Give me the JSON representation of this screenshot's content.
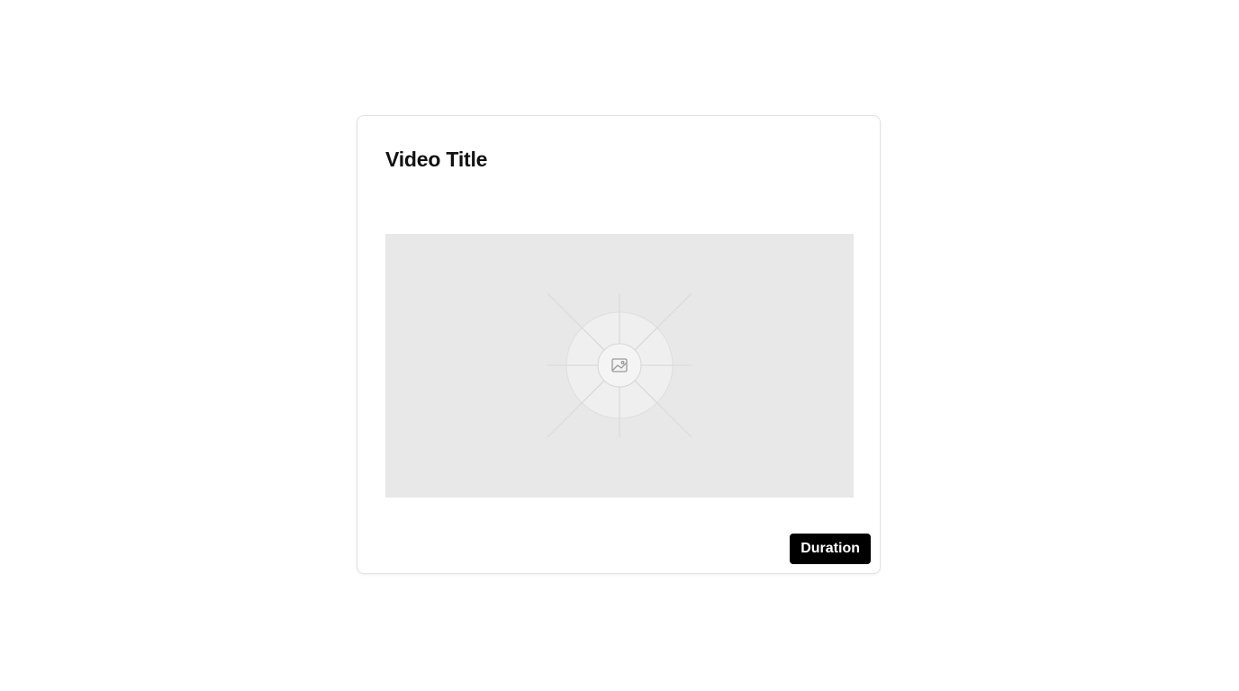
{
  "card": {
    "title": "Video Title",
    "duration_label": "Duration",
    "thumbnail_icon": "image-placeholder-icon"
  },
  "colors": {
    "badge_background": "#000000",
    "badge_text": "#ffffff",
    "thumbnail_background": "#e8e8e8",
    "title_text": "#111111"
  }
}
